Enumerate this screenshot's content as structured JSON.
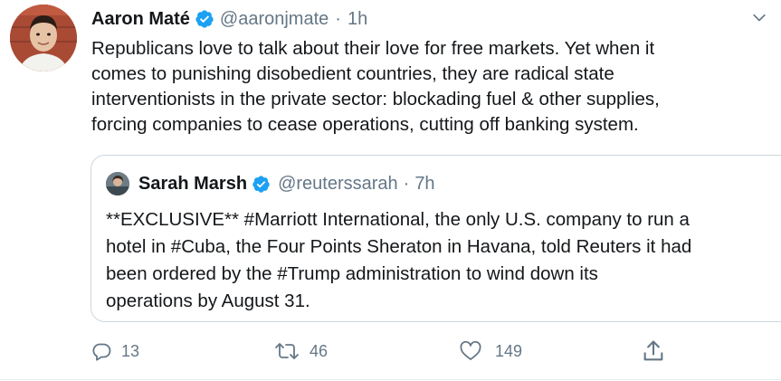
{
  "tweet": {
    "author": {
      "name": "Aaron Maté",
      "handle": "@aaronjmate",
      "verified": true
    },
    "separator": "·",
    "time": "1h",
    "text": "Republicans love to talk about their love for free markets. Yet when it\ncomes to punishing disobedient countries, they are radical state\ninterventionists in the private sector: blockading fuel & other supplies,\nforcing companies to cease operations, cutting off banking system.",
    "quoted": {
      "author": {
        "name": "Sarah Marsh",
        "handle": "@reuterssarah",
        "verified": true
      },
      "separator": "·",
      "time": "7h",
      "text": "**EXCLUSIVE** #Marriott International, the only U.S. company to run a\nhotel in #Cuba, the Four Points Sheraton in Havana, told Reuters it had\nbeen ordered by the #Trump administration to wind down its\noperations by August 31."
    },
    "actions": {
      "reply_count": "13",
      "retweet_count": "46",
      "like_count": "149"
    }
  },
  "colors": {
    "text": "#14171a",
    "muted": "#657786",
    "verified_blue": "#1da1f2",
    "border": "#ccd6dd"
  },
  "icons": {
    "caret": "chevron-down-icon",
    "reply": "reply-icon",
    "retweet": "retweet-icon",
    "like": "heart-icon",
    "share": "share-icon",
    "verified": "verified-badge-icon"
  }
}
